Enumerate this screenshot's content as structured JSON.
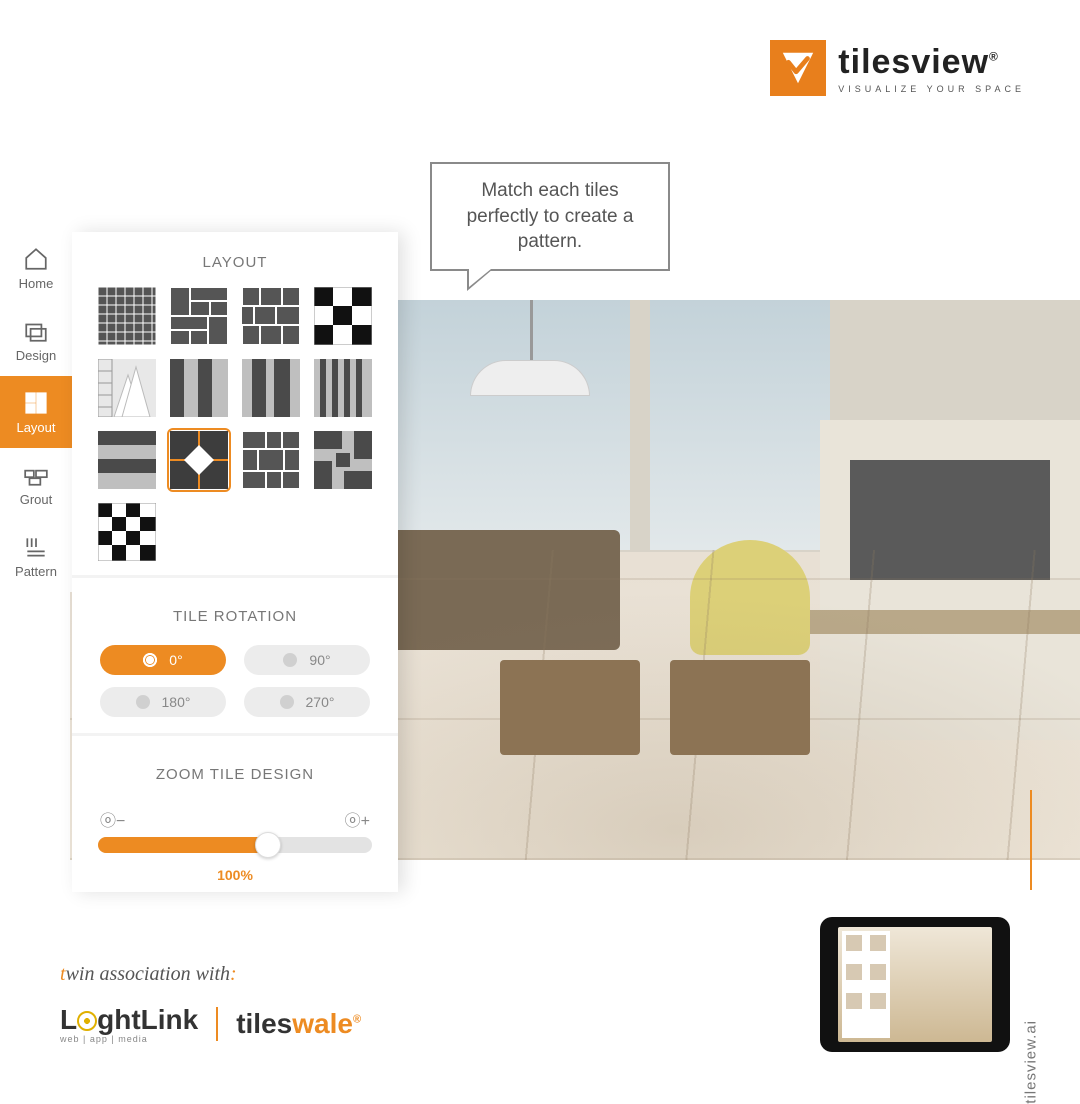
{
  "brand": {
    "name": "tilesview",
    "reg": "®",
    "tagline": "VISUALIZE YOUR SPACE"
  },
  "speech": "Match each tiles perfectly to create a pattern.",
  "nav": {
    "home": "Home",
    "design": "Design",
    "layout": "Layout",
    "grout": "Grout",
    "pattern": "Pattern"
  },
  "panel": {
    "layout_title": "LAYOUT",
    "layouts": [
      "grid-small",
      "brick-mix",
      "brick-offset",
      "checker-large",
      "triangles",
      "stripes-vert",
      "stripes-varied",
      "stripes-thin",
      "bands-horiz",
      "diamond-center",
      "weave-blocks",
      "pinwheel",
      "checker-offset"
    ],
    "selected_layout_index": 9,
    "rotation_title": "TILE ROTATION",
    "rotation": {
      "r0": "0°",
      "r90": "90°",
      "r180": "180°",
      "r270": "270°",
      "active": "r0"
    },
    "zoom_title": "ZOOM TILE DESIGN",
    "zoom": {
      "percent": 100,
      "display": "100%"
    }
  },
  "footer": {
    "assoc_prefix": "t",
    "assoc_text": "win association with",
    "assoc_colon": ":",
    "lightlink": {
      "pre": "L",
      "post": "ghtLink",
      "sub": "web | app | media"
    },
    "tileswale_a": "tiles",
    "tileswale_b": "wale",
    "tileswale_reg": "®",
    "url": "tilesview.ai"
  },
  "colors": {
    "accent": "#ed8b22"
  }
}
